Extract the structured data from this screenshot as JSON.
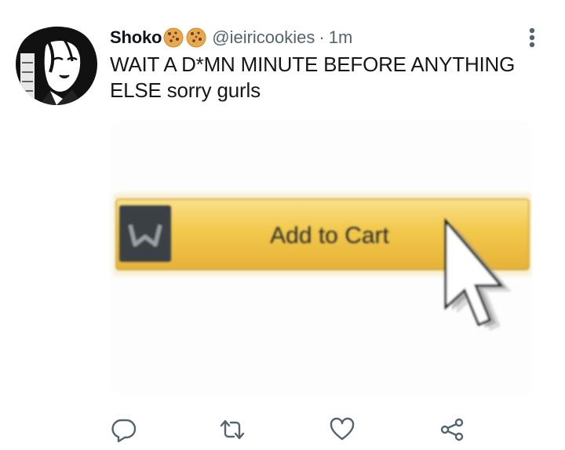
{
  "tweet": {
    "display_name": "Shoko",
    "name_emojis": [
      "cookie-emoji",
      "cookie-emoji"
    ],
    "handle": "@ieiricookies",
    "separator": "·",
    "time": "1m",
    "text": "WAIT A D*MN MINUTE BEFORE ANYTHING ELSE sorry gurls"
  },
  "media": {
    "button_label": "Add to Cart",
    "button_color": "#f2c84b",
    "icon": "amazon-prime-logo",
    "cursor": "mouse-pointer-cursor"
  },
  "actions": [
    {
      "name": "reply",
      "icon": "speech-bubble-icon"
    },
    {
      "name": "retweet",
      "icon": "retweet-arrows-icon"
    },
    {
      "name": "like",
      "icon": "heart-icon"
    },
    {
      "name": "share",
      "icon": "share-nodes-icon"
    }
  ],
  "colors": {
    "text": "#14171a",
    "secondary_text": "#536471",
    "icon": "#536471"
  }
}
